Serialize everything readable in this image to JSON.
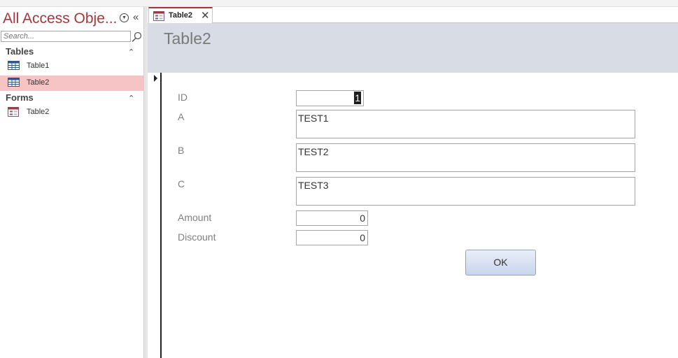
{
  "nav": {
    "title": "All Access Obje...",
    "search_placeholder": "Search...",
    "groups": [
      {
        "label": "Tables",
        "items": [
          {
            "label": "Table1",
            "selected": false
          },
          {
            "label": "Table2",
            "selected": true
          }
        ]
      },
      {
        "label": "Forms",
        "items": [
          {
            "label": "Table2",
            "selected": false
          }
        ]
      }
    ]
  },
  "tab": {
    "label": "Table2"
  },
  "form": {
    "title": "Table2",
    "fields": [
      {
        "label": "ID",
        "value": "1"
      },
      {
        "label": "A",
        "value": "TEST1"
      },
      {
        "label": "B",
        "value": "TEST2"
      },
      {
        "label": "C",
        "value": "TEST3"
      },
      {
        "label": "Amount",
        "value": "0"
      },
      {
        "label": "Discount",
        "value": "0"
      }
    ],
    "ok_label": "OK"
  },
  "colors": {
    "accent": "#a4373a",
    "selected_bg": "#f7c4c5",
    "header_band": "#d7dce5"
  }
}
